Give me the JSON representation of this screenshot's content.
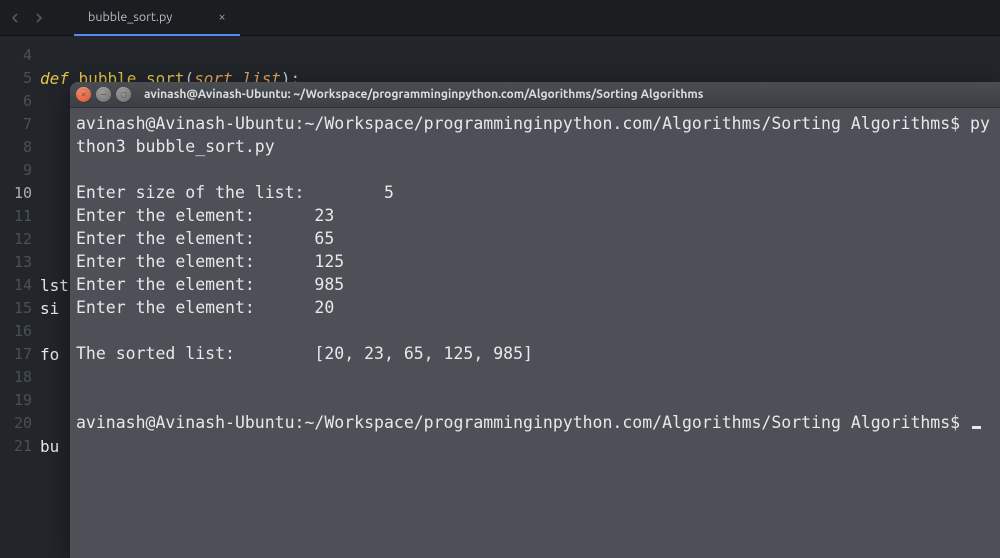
{
  "tab": {
    "filename": "bubble_sort.py"
  },
  "gutter": [
    "4",
    "5",
    "6",
    "7",
    "8",
    "9",
    "10",
    "11",
    "12",
    "13",
    "14",
    "15",
    "16",
    "17",
    "18",
    "19",
    "20",
    "21"
  ],
  "gutter_current_index": 6,
  "code": {
    "def_kw": "def",
    "fn_name": "bubble_sort",
    "param": "sort_list",
    "line13": "lst",
    "line14": "si",
    "line16": "fo",
    "line20": "bu"
  },
  "terminal": {
    "title": "avinash@Avinash-Ubuntu: ~/Workspace/programminginpython.com/Algorithms/Sorting Algorithms",
    "prompt_path": "avinash@Avinash-Ubuntu:~/Workspace/programminginpython.com/Algorithms/Sorting Algorithms$",
    "command": "python3 bubble_sort.py",
    "io": [
      "Enter size of the list:        5",
      "Enter the element:      23",
      "Enter the element:      65",
      "Enter the element:      125",
      "Enter the element:      985",
      "Enter the element:      20"
    ],
    "result": "The sorted list:        [20, 23, 65, 125, 985]"
  }
}
